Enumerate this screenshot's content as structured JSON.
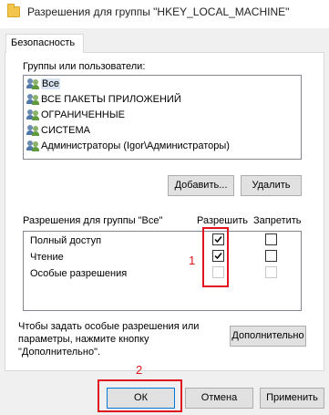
{
  "window": {
    "title": "Разрешения для группы \"HKEY_LOCAL_MACHINE\""
  },
  "tabs": [
    {
      "label": "Безопасность"
    }
  ],
  "groups": {
    "label": "Группы или пользователи:",
    "items": [
      {
        "label": "Все",
        "selected": true
      },
      {
        "label": "ВСЕ ПАКЕТЫ ПРИЛОЖЕНИЙ",
        "selected": false
      },
      {
        "label": "ОГРАНИЧЕННЫЕ",
        "selected": false
      },
      {
        "label": "СИСТЕМА",
        "selected": false
      },
      {
        "label": "Администраторы (Igor\\Администраторы)",
        "selected": false
      }
    ],
    "add_button": "Добавить...",
    "remove_button": "Удалить"
  },
  "permissions": {
    "label": "Разрешения для группы \"Все\"",
    "allow_header": "Разрешить",
    "deny_header": "Запретить",
    "rows": [
      {
        "label": "Полный доступ",
        "allow": true,
        "deny": false,
        "enabled": true
      },
      {
        "label": "Чтение",
        "allow": true,
        "deny": false,
        "enabled": true
      },
      {
        "label": "Особые разрешения",
        "allow": false,
        "deny": false,
        "enabled": false
      }
    ]
  },
  "advanced": {
    "text_line1": "Чтобы задать особые разрешения или",
    "text_line2": "параметры, нажмите кнопку",
    "text_line3": "\"Дополнительно\".",
    "button": "Дополнительно"
  },
  "footer": {
    "ok": "ОК",
    "cancel": "Отмена",
    "apply": "Применить"
  },
  "annotations": {
    "marker1": "1",
    "marker2": "2",
    "color": "#e0141e"
  }
}
